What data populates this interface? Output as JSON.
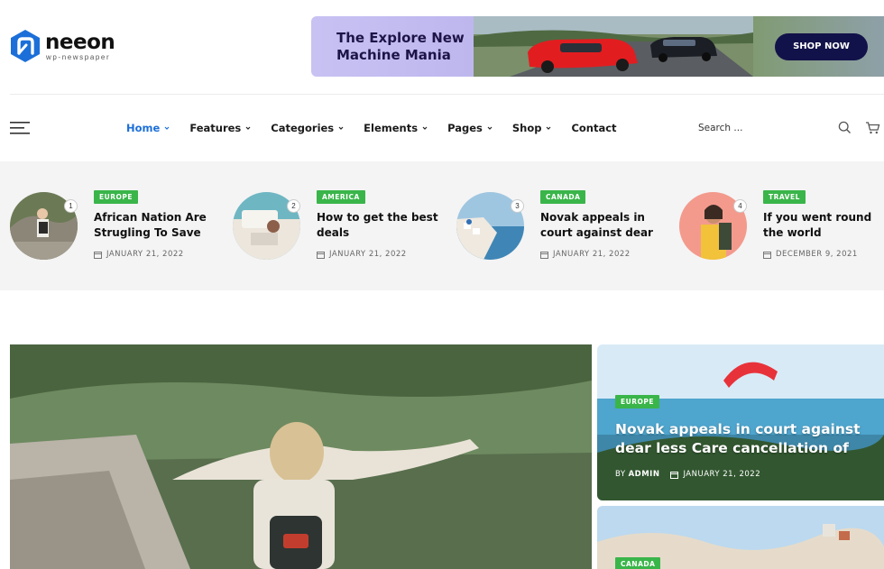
{
  "brand": {
    "name": "neeon",
    "tagline": "wp-newspaper",
    "accent": "#1c6fd8"
  },
  "banner": {
    "title_line1": "The Explore New",
    "title_line2": "Machine Mania",
    "cta": "SHOP NOW"
  },
  "nav": {
    "items": [
      {
        "label": "Home",
        "has_dropdown": true,
        "active": true
      },
      {
        "label": "Features",
        "has_dropdown": true
      },
      {
        "label": "Categories",
        "has_dropdown": true
      },
      {
        "label": "Elements",
        "has_dropdown": true
      },
      {
        "label": "Pages",
        "has_dropdown": true
      },
      {
        "label": "Shop",
        "has_dropdown": true
      },
      {
        "label": "Contact",
        "has_dropdown": false
      }
    ],
    "search_placeholder": "Search ...",
    "icons": [
      "menu-icon",
      "search-icon",
      "cart-icon"
    ]
  },
  "trending": [
    {
      "rank": "1",
      "category": "EUROPE",
      "title": "African Nation Are Strugling To Save",
      "date": "JANUARY 21, 2022"
    },
    {
      "rank": "2",
      "category": "AMERICA",
      "title": "How to get the best deals",
      "date": "JANUARY 21, 2022"
    },
    {
      "rank": "3",
      "category": "CANADA",
      "title": "Novak appeals in court against dear",
      "date": "JANUARY 21, 2022"
    },
    {
      "rank": "4",
      "category": "TRAVEL",
      "title": "If you went round the world",
      "date": "DECEMBER 9, 2021"
    }
  ],
  "hero": {
    "side": [
      {
        "category": "EUROPE",
        "title": "Novak appeals in court against dear less Care cancellation of",
        "by": "BY",
        "author": "ADMIN",
        "date": "JANUARY 21, 2022"
      },
      {
        "category": "CANADA"
      }
    ]
  },
  "colors": {
    "category_badge": "#3ab54a",
    "strip_bg": "#f4f4f4"
  }
}
